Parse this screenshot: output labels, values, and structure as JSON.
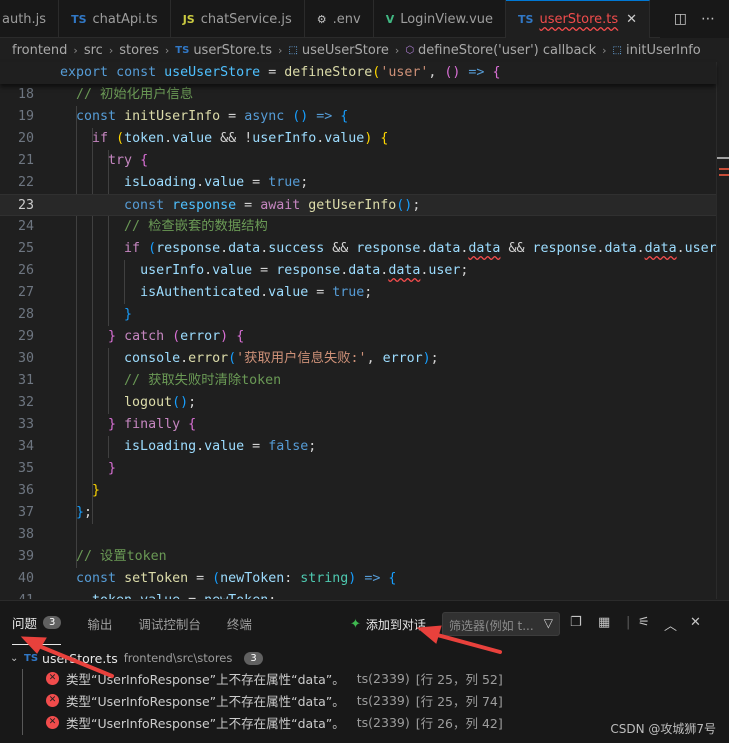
{
  "tabs": [
    {
      "icon": "",
      "label": "auth.js"
    },
    {
      "icon": "TS",
      "label": "chatApi.ts"
    },
    {
      "icon": "JS",
      "label": "chatService.js"
    },
    {
      "icon": "⚙",
      "label": ".env"
    },
    {
      "icon": "V",
      "label": "LoginView.vue"
    },
    {
      "icon": "TS",
      "label": "userStore.ts",
      "active": true
    }
  ],
  "breadcrumb": [
    "frontend",
    "src",
    "stores",
    "userStore.ts",
    "useUserStore",
    "defineStore('user') callback",
    "initUserInfo"
  ],
  "sticky_line": "export const useUserStore = defineStore('user', () => {",
  "line_numbers": [
    "18",
    "19",
    "20",
    "21",
    "22",
    "23",
    "24",
    "25",
    "26",
    "27",
    "28",
    "29",
    "30",
    "31",
    "32",
    "33",
    "34",
    "35",
    "36",
    "37",
    "38",
    "39",
    "40",
    "41"
  ],
  "current_line": "23",
  "panel": {
    "tabs": [
      {
        "label": "问题",
        "count": "3",
        "active": true
      },
      {
        "label": "输出"
      },
      {
        "label": "调试控制台"
      },
      {
        "label": "终端"
      }
    ],
    "add_to_chat": "添加到对话",
    "filter_placeholder": "筛选器(例如 t...",
    "file": {
      "name": "userStore.ts",
      "path": "frontend\\src\\stores",
      "count": "3"
    },
    "problems": [
      {
        "message": "类型“UserInfoResponse”上不存在属性“data”。",
        "code": "ts(2339)",
        "location": "[行 25，列 52]"
      },
      {
        "message": "类型“UserInfoResponse”上不存在属性“data”。",
        "code": "ts(2339)",
        "location": "[行 25，列 74]"
      },
      {
        "message": "类型“UserInfoResponse”上不存在属性“data”。",
        "code": "ts(2339)",
        "location": "[行 26，列 42]"
      }
    ]
  },
  "watermark": "CSDN @攻城狮7号",
  "colors": {
    "error": "#f14c4c",
    "annotation_arrow": "#e8413c",
    "accent": "#0078d4"
  }
}
